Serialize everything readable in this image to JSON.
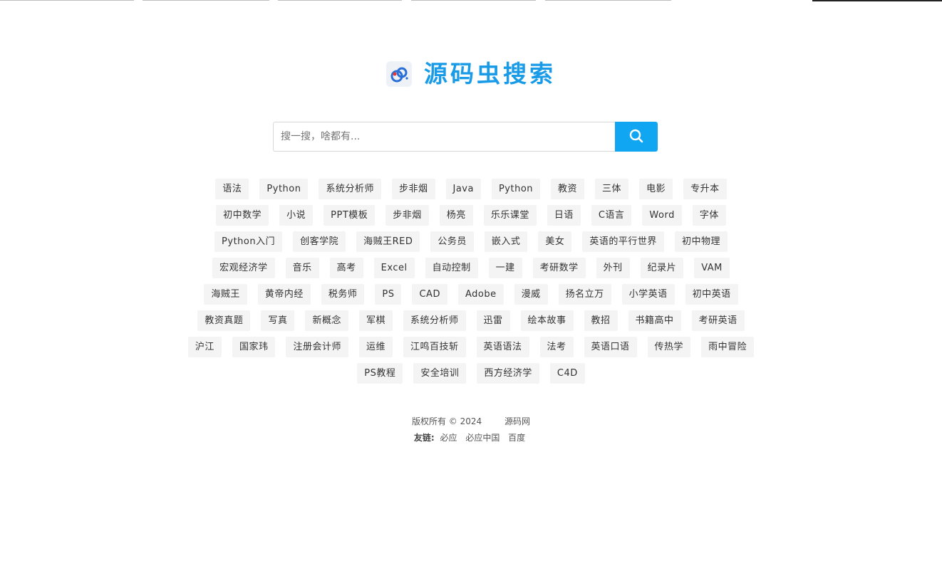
{
  "logo": {
    "title": "源码虫搜索",
    "icon": "logo-icon",
    "color": "#1a9be8"
  },
  "search": {
    "placeholder": "搜一搜，啥都有...",
    "value": "",
    "button_icon": "search-icon",
    "button_color": "#10a6f2"
  },
  "tags": [
    [
      "语法",
      "Python",
      "系统分析师",
      "步非烟",
      "Java",
      "Python",
      "教资",
      "三体",
      "电影",
      "专升本"
    ],
    [
      "初中数学",
      "小说",
      "PPT模板",
      "步非烟",
      "杨亮",
      "乐乐课堂",
      "日语",
      "C语言",
      "Word",
      "字体"
    ],
    [
      "Python入门",
      "创客学院",
      "海贼王RED",
      "公务员",
      "嵌入式",
      "美女",
      "英语的平行世界",
      "初中物理"
    ],
    [
      "宏观经济学",
      "音乐",
      "高考",
      "Excel",
      "自动控制",
      "一建",
      "考研数学",
      "外刊",
      "纪录片",
      "VAM"
    ],
    [
      "海贼王",
      "黄帝内经",
      "税务师",
      "PS",
      "CAD",
      "Adobe",
      "漫威",
      "扬名立万",
      "小学英语",
      "初中英语"
    ],
    [
      "教资真题",
      "写真",
      "新概念",
      "军棋",
      "系统分析师",
      "迅雷",
      "绘本故事",
      "教招",
      "书籍高中",
      "考研英语"
    ],
    [
      "沪江",
      "国家玮",
      "注册会计师",
      "运维",
      "江鸣百技斩",
      "英语语法",
      "法考",
      "英语口语",
      "传热学",
      "雨中冒险"
    ],
    [
      "PS教程",
      "安全培训",
      "西方经济学",
      "C4D"
    ]
  ],
  "footer": {
    "copyright": "版权所有 © 2024",
    "site_name": "源码网",
    "friends_label": "友链:",
    "friend_links": [
      "必应",
      "必应中国",
      "百度"
    ]
  }
}
